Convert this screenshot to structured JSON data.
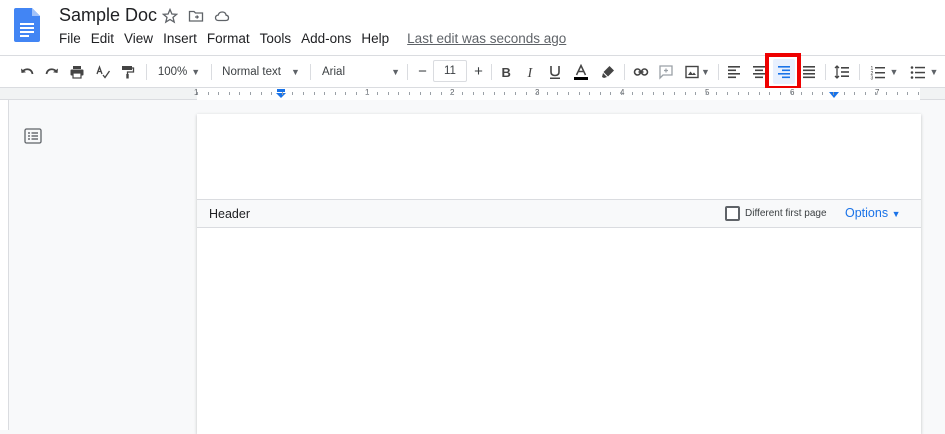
{
  "document": {
    "title": "Sample Doc"
  },
  "menu": {
    "items": [
      "File",
      "Edit",
      "View",
      "Insert",
      "Format",
      "Tools",
      "Add-ons",
      "Help"
    ],
    "last_edit": "Last edit was seconds ago"
  },
  "toolbar": {
    "zoom": "100%",
    "style": "Normal text",
    "font": "Arial",
    "font_size": "11",
    "minus": "−",
    "plus": "+"
  },
  "ruler": {
    "numbers": [
      "1",
      "1",
      "2",
      "3",
      "4",
      "5",
      "6",
      "7"
    ]
  },
  "header_section": {
    "label": "Header",
    "different_first_page": "Different first page",
    "options": "Options"
  },
  "colors": {
    "accent": "#1a73e8",
    "highlight_border": "#ee0000",
    "docs_blue": "#4285f4"
  }
}
